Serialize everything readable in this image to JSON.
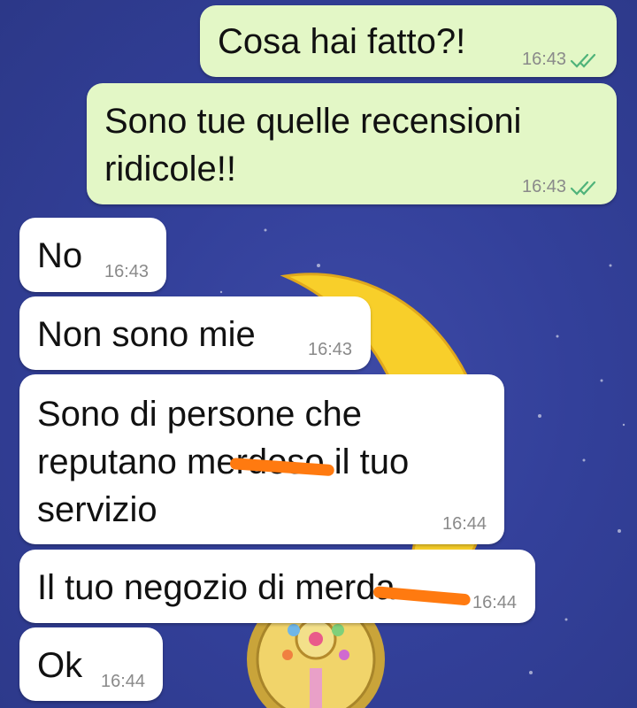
{
  "chat": {
    "colors": {
      "outgoing_bubble": "#e3f7c6",
      "incoming_bubble": "#ffffff",
      "read_ticks": "#4fb37a",
      "redaction": "#ff7a10",
      "wallpaper": "#33409a"
    },
    "messages": [
      {
        "direction": "outgoing",
        "text": "Cosa hai fatto?!",
        "time": "16:43",
        "status": "read"
      },
      {
        "direction": "outgoing",
        "text": "Sono tue quelle recensioni\nridicole!!",
        "time": "16:43",
        "status": "read"
      },
      {
        "direction": "incoming",
        "text": "No",
        "time": "16:43"
      },
      {
        "direction": "incoming",
        "text": "Non sono mie",
        "time": "16:43"
      },
      {
        "direction": "incoming",
        "text": "Sono di persone che\nreputano merdoso il tuo\nservizio",
        "time": "16:44",
        "redacted_word": "merdoso"
      },
      {
        "direction": "incoming",
        "text": "Il tuo negozio di merda",
        "time": "16:44",
        "redacted_word": "merda"
      },
      {
        "direction": "incoming",
        "text": "Ok",
        "time": "16:44"
      }
    ]
  }
}
